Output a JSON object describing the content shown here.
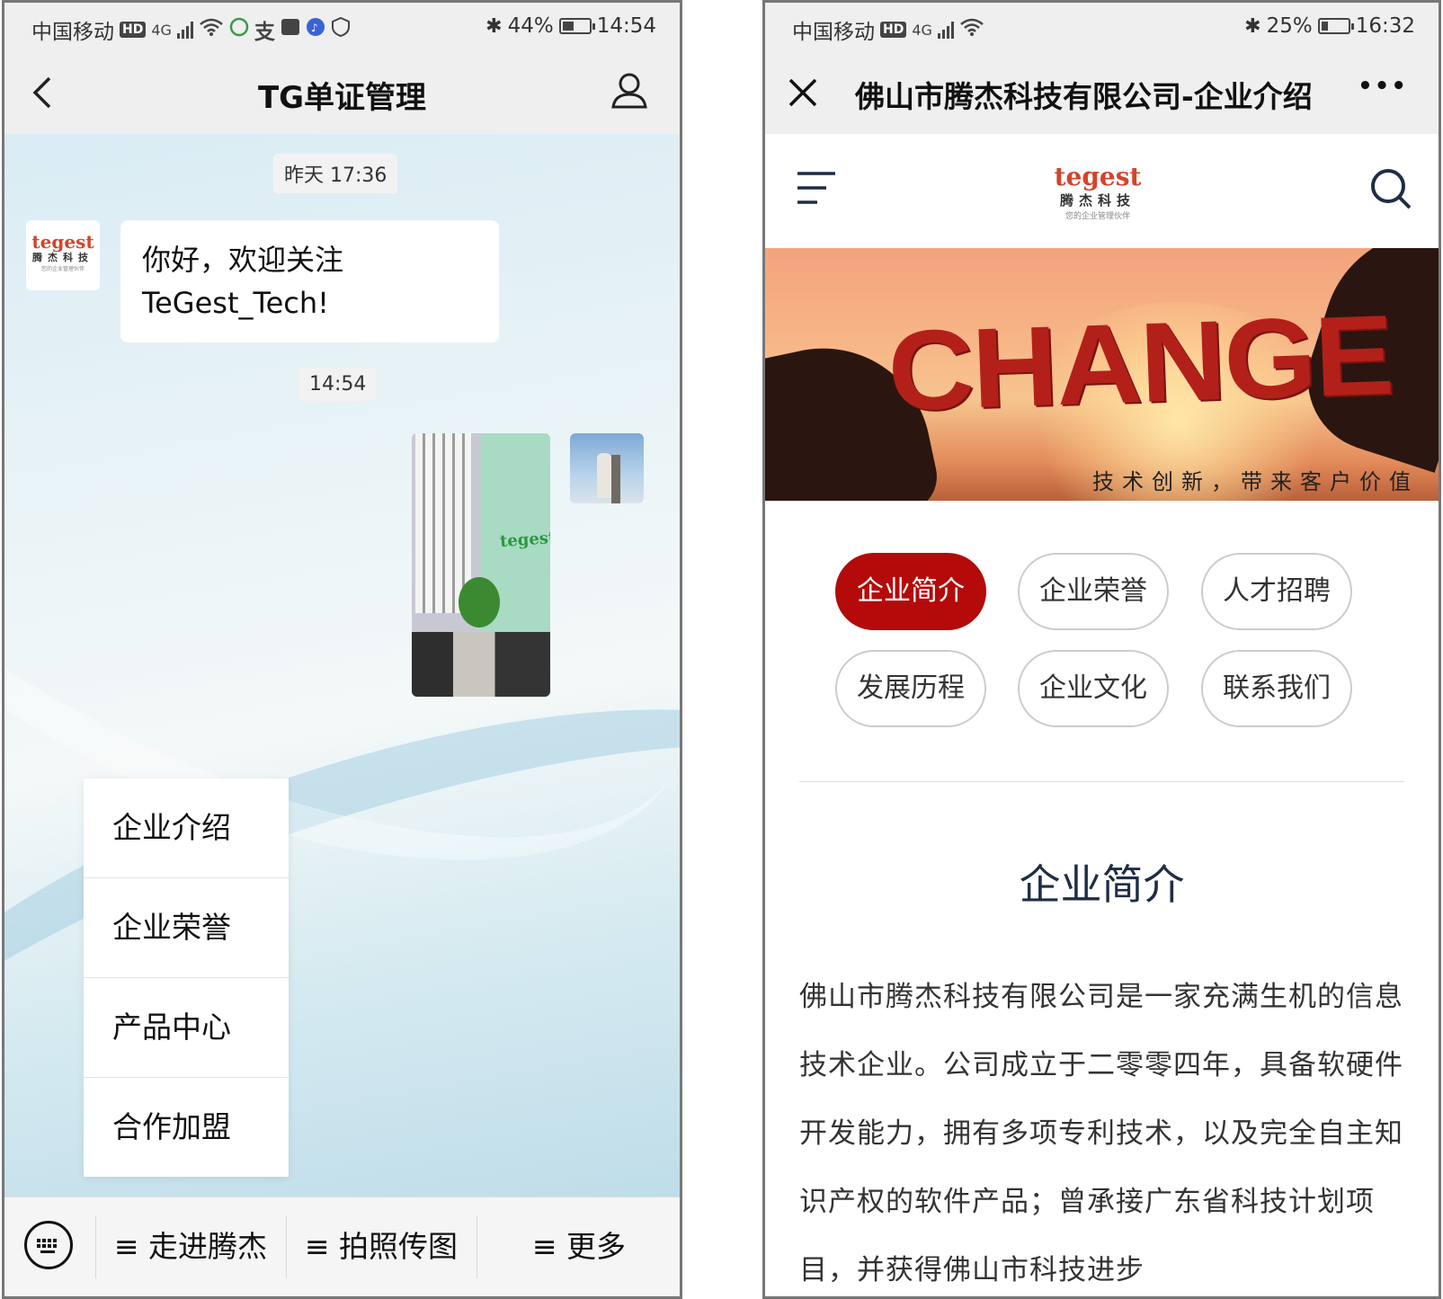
{
  "left_phone": {
    "status": {
      "carrier": "中国移动",
      "network": "4G",
      "battery": "44%",
      "battery_level": 0.44,
      "time": "14:54"
    },
    "nav": {
      "title": "TG单证管理"
    },
    "chat": {
      "timestamp_1": "昨天 17:36",
      "welcome_message": "你好，欢迎关注 TeGest_Tech!",
      "timestamp_2": "14:54",
      "bot_logo": {
        "word": "tegest",
        "cn": "腾杰科技",
        "sub": "您的企业管理伙伴"
      },
      "photo_logo_text": "tegest"
    },
    "popup_menu": [
      "企业介绍",
      "企业荣誉",
      "产品中心",
      "合作加盟"
    ],
    "bottom_menu": [
      "≡ 走进腾杰",
      "≡ 拍照传图",
      "≡ 更多"
    ]
  },
  "right_phone": {
    "status": {
      "carrier": "中国移动",
      "network": "4G",
      "battery": "25%",
      "battery_level": 0.25,
      "time": "16:32"
    },
    "nav": {
      "title": "佛山市腾杰科技有限公司-企业介绍",
      "more": "•••"
    },
    "site_logo": {
      "word": "tegest",
      "cn": "腾杰科技",
      "sub": "您的企业管理伙伴"
    },
    "banner": {
      "headline": "CHANGE",
      "caption": "技术创新，带来客户价值"
    },
    "tabs": [
      "企业简介",
      "企业荣誉",
      "人才招聘",
      "发展历程",
      "企业文化",
      "联系我们"
    ],
    "active_tab": "企业简介",
    "section": {
      "title": "企业简介",
      "body": "佛山市腾杰科技有限公司是一家充满生机的信息技术企业。公司成立于二零零四年，具备软硬件开发能力，拥有多项专利技术，以及完全自主知识产权的软件产品；曾承接广东省科技计划项目，并获得佛山市科技进步"
    }
  },
  "colors": {
    "accent_red": "#b40a0a",
    "logo_red": "#d4442a",
    "logo_green": "#2a9a3c",
    "title_navy": "#1f2d45"
  }
}
